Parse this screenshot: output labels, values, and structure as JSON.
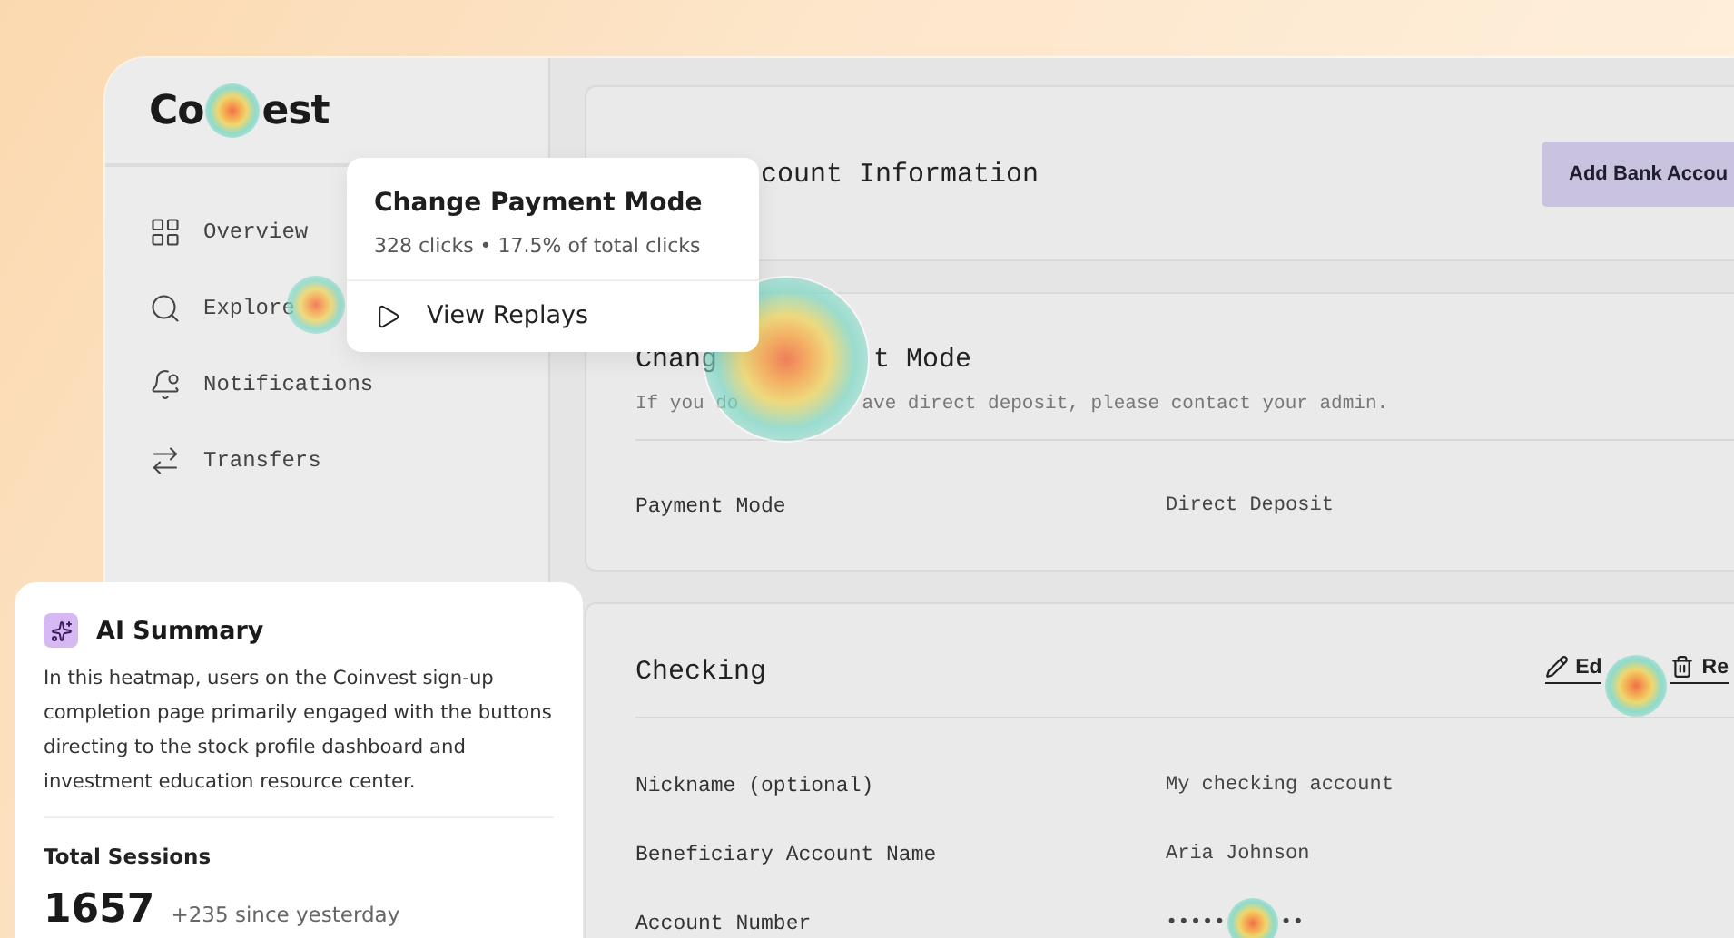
{
  "logo": {
    "start": "Co",
    "end": "est"
  },
  "sidebar": {
    "items": [
      {
        "label": "Overview",
        "kind": "grid"
      },
      {
        "label": "Explore",
        "kind": "search"
      },
      {
        "label": "Notifications",
        "kind": "bell"
      },
      {
        "label": "Transfers",
        "kind": "transfer"
      }
    ]
  },
  "account_card": {
    "title": "count Information",
    "button": "Add Bank Accou"
  },
  "payment_card": {
    "title_start": "Chang",
    "title_end": "t Mode",
    "note_start": "If you do",
    "note_end": "ave direct deposit, please contact your admin.",
    "rows": [
      {
        "label": "Payment Mode",
        "value": "Direct Deposit"
      }
    ]
  },
  "checking_card": {
    "title": "Checking",
    "actions": [
      {
        "label": "Ed",
        "kind": "edit"
      },
      {
        "label": "Re",
        "kind": "remove"
      }
    ],
    "rows": [
      {
        "label": "Nickname (optional)",
        "value": "My checking account"
      },
      {
        "label": "Beneficiary Account Name",
        "value": "Aria Johnson"
      },
      {
        "label": "Account Number",
        "value": "•••••",
        "value_end": "••"
      }
    ]
  },
  "popup": {
    "title": "Change Payment Mode",
    "subtitle": "328 clicks • 17.5% of total clicks",
    "action": "View Replays"
  },
  "summary": {
    "title": "AI Summary",
    "text": "In this heatmap, users on the Coinvest sign-up completion page primarily engaged with the buttons directing to the stock profile dashboard and investment education resource center.",
    "sessions_label": "Total Sessions",
    "sessions_value": "1657",
    "sessions_change": "+235 since yesterday"
  }
}
